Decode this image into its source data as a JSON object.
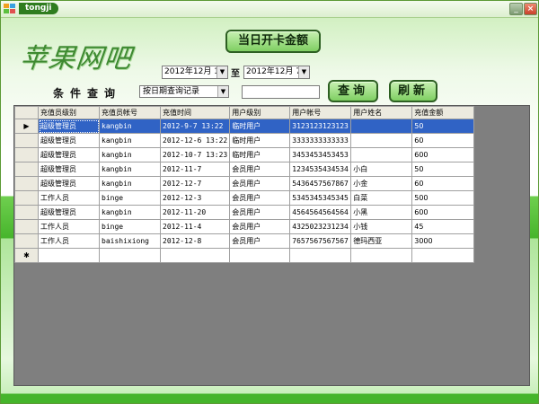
{
  "window": {
    "title": "tongji",
    "minimize_glyph": "_",
    "close_glyph": "×",
    "accent": "#2f7d1f"
  },
  "logo": {
    "text": "苹果网吧"
  },
  "actions": {
    "kaika_label": "当日开卡金额",
    "query_label": "查询",
    "refresh_label": "刷新"
  },
  "filter": {
    "start_date": "2012年12月 1日",
    "end_date": "2012年12月 7日",
    "to_label": "至",
    "condition_label": "条件查询",
    "condition_selected": "按日期查询记录",
    "keyword_value": ""
  },
  "grid": {
    "columns": [
      "充值员级别",
      "充值员帐号",
      "充值时间",
      "用户级别",
      "用户帐号",
      "用户姓名",
      "充值金额"
    ],
    "current_row_marker": "▶",
    "new_row_marker": "✱",
    "rows": [
      [
        "超级管理员",
        "kangbin",
        "2012-9-7 13:22",
        "临时用户",
        "3123123123123",
        "",
        "50"
      ],
      [
        "超级管理员",
        "kangbin",
        "2012-12-6 13:22",
        "临时用户",
        "3333333333333",
        "",
        "60"
      ],
      [
        "超级管理员",
        "kangbin",
        "2012-10-7 13:23",
        "临时用户",
        "3453453453453",
        "",
        "600"
      ],
      [
        "超级管理员",
        "kangbin",
        "2012-11-7",
        "会员用户",
        "1234535434534",
        "小白",
        "50"
      ],
      [
        "超级管理员",
        "kangbin",
        "2012-12-7",
        "会员用户",
        "5436457567867",
        "小金",
        "60"
      ],
      [
        "工作人员",
        "binge",
        "2012-12-3",
        "会员用户",
        "5345345345345",
        "白菜",
        "500"
      ],
      [
        "超级管理员",
        "kangbin",
        "2012-11-20",
        "会员用户",
        "4564564564564",
        "小黑",
        "600"
      ],
      [
        "工作人员",
        "binge",
        "2012-11-4",
        "会员用户",
        "4325023231234",
        "小钱",
        "45"
      ],
      [
        "工作人员",
        "baishixiong",
        "2012-12-8",
        "会员用户",
        "7657567567567",
        "德玛西亚",
        "3000"
      ]
    ]
  }
}
